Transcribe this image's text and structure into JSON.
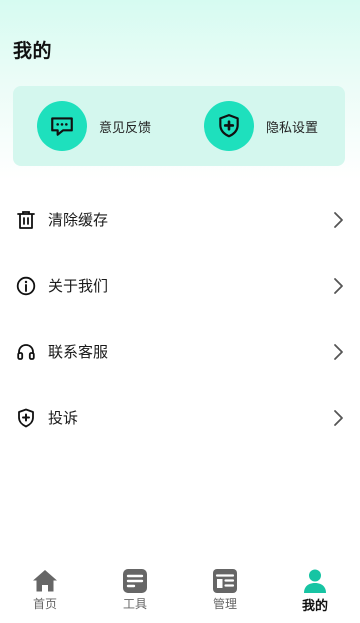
{
  "header": {
    "title": "我的"
  },
  "quick_actions": [
    {
      "label": "意见反馈",
      "icon": "message-icon"
    },
    {
      "label": "隐私设置",
      "icon": "shield-plus-icon"
    }
  ],
  "menu": [
    {
      "label": "清除缓存",
      "icon": "trash-icon"
    },
    {
      "label": "关于我们",
      "icon": "info-icon"
    },
    {
      "label": "联系客服",
      "icon": "headset-icon"
    },
    {
      "label": "投诉",
      "icon": "shield-plus-icon"
    }
  ],
  "tabbar": {
    "active": "我的",
    "tabs": [
      {
        "label": "首页",
        "icon": "home-icon"
      },
      {
        "label": "工具",
        "icon": "tools-icon"
      },
      {
        "label": "管理",
        "icon": "manage-icon"
      },
      {
        "label": "我的",
        "icon": "profile-icon"
      }
    ]
  },
  "colors": {
    "accent": "#1ee0bd",
    "card_bg": "#d4f7ee",
    "tab_inactive": "#666666",
    "tab_active_icon": "#17c4a3"
  }
}
